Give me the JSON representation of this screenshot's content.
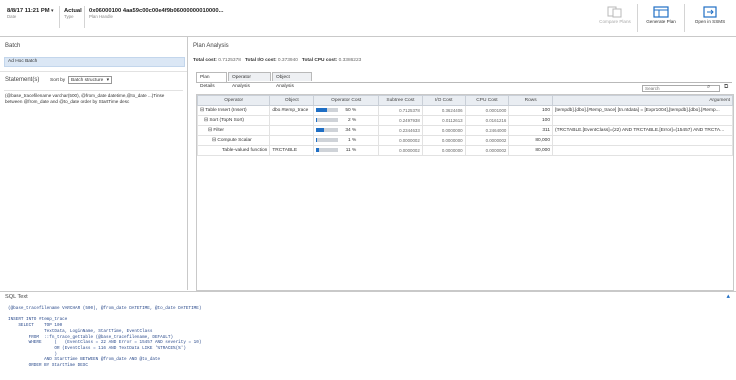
{
  "header": {
    "date_value": "8/8/17 11:21 PM",
    "date_label": "Date",
    "type_value": "Actual",
    "type_label": "Type",
    "plan_handle_value": "0x06000100 4aa59c00c00e4f9b06000000010000...",
    "plan_handle_label": "Plan Handle",
    "compare_plans": "Compare Plans",
    "generate_plan": "Generate Plan",
    "open_in_ssms": "Open in SSMS"
  },
  "left": {
    "batch_title": "Batch",
    "batch_item": "Ad Hoc Batch",
    "statements_title": "Statement(s)",
    "sort_label": "Sort by",
    "sort_value": "Batch structure",
    "statement_text": "(@base_tracefilename varchar(500), @from_date datetime,@to_date ...)Tinse between @from_date and @to_date order by StartTime desc"
  },
  "plan": {
    "title": "Plan Analysis",
    "total_cost_label": "Total cost:",
    "total_cost_value": "0.7125378",
    "total_io_label": "Total I/O cost:",
    "total_io_value": "0.373940",
    "total_cpu_label": "Total CPU cost:",
    "total_cpu_value": "0.3386223",
    "tabs": [
      "Plan Details",
      "Operator Analysis",
      "Object Analysis"
    ],
    "search_placeholder": "Search"
  },
  "grid": {
    "columns": [
      "Operator",
      "Object",
      "Operator Cost",
      "Subtree Cost",
      "I/O Cost",
      "CPU Cost",
      "Rows",
      "Argument"
    ],
    "rows": [
      {
        "operator": "⊟ Table Insert (Insert)",
        "object": "dbo.#temp_trace",
        "cost_pct": "50 %",
        "subtree": "0.7125378",
        "io": "0.3624406",
        "cpu": "0.0001000",
        "rows": "100",
        "argument": "[tempdb].[dbo].[#temp_trace] [tn.ntdata] = [Expr1004],[tempdb].[dbo].[#temp..."
      },
      {
        "operator": "⊟ Sort (TopN Sort)",
        "object": "",
        "cost_pct": "2 %",
        "subtree": "0.2497938",
        "io": "0.0112613",
        "cpu": "0.0161216",
        "rows": "100",
        "argument": ""
      },
      {
        "operator": "⊟ Filter",
        "object": "",
        "cost_pct": "34 %",
        "subtree": "0.2344633",
        "io": "0.0000000",
        "cpu": "0.2464000",
        "rows": "311",
        "argument": "(TRCTABLE.[EventClass]=(22) AND TRCTABLE.[Error]=(15457) AND TRCTA..."
      },
      {
        "operator": "⊟ Compute Scalar",
        "object": "",
        "cost_pct": "1 %",
        "subtree": "0.0000002",
        "io": "0.0000000",
        "cpu": "0.0000002",
        "rows": "80,000",
        "argument": ""
      },
      {
        "operator": "Table-valued function",
        "object": "TRCTABLE",
        "cost_pct": "11 %",
        "subtree": "0.0000002",
        "io": "0.0000000",
        "cpu": "0.0000002",
        "rows": "80,000",
        "argument": ""
      }
    ],
    "cost_fractions": [
      0.5,
      0.02,
      0.34,
      0.01,
      0.11
    ]
  },
  "sql": {
    "title": "SQL Text",
    "text": "(@base_tracefilename VARCHAR (500), @from_date DATETIME, @to_date DATETIME)\n\nINSERT INTO #temp_trace\n    SELECT    TOP 100\n              TextData, LoginName, StartTime, EventClass\n        FROM  ::fn_trace_gettable (@base_tracefilename, DEFAULT)\n        WHERE     (   (EventClass = 22 AND Error = 15457 AND severity = 10)\n                  OR (EventClass = 116 AND TextData LIKE '%TRACE%(%')\n                  )\n              AND StartTime BETWEEN @from_date AND @to_date\n        ORDER BY StartTime DESC"
  },
  "colors": {
    "accent": "#1f6fc5",
    "selection": "#dbe7f5",
    "header_bg": "#e9edf2"
  }
}
